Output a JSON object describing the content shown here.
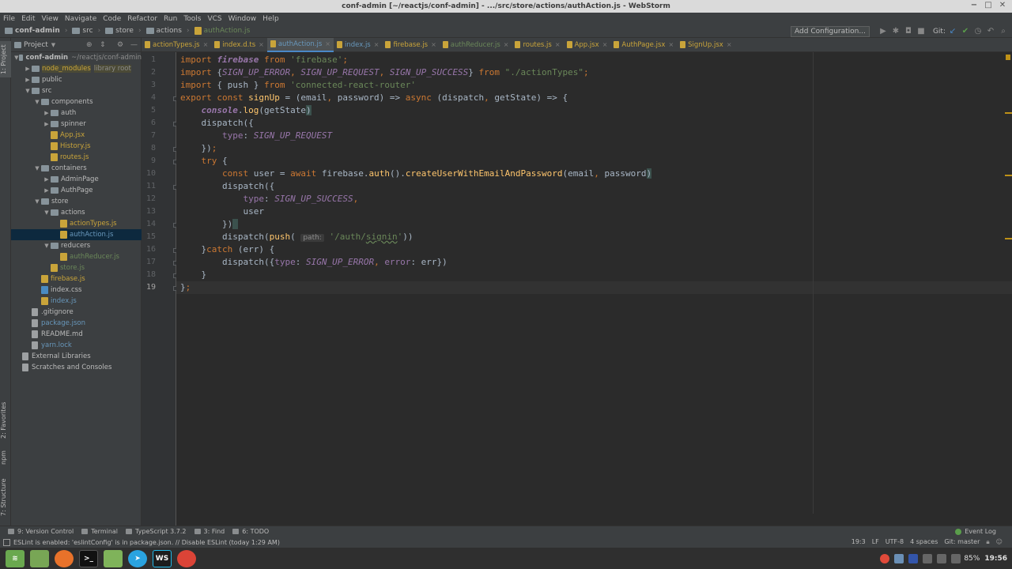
{
  "window": {
    "title": "conf-admin [~/reactjs/conf-admin] - .../src/store/actions/authAction.js - WebStorm"
  },
  "menu": [
    "File",
    "Edit",
    "View",
    "Navigate",
    "Code",
    "Refactor",
    "Run",
    "Tools",
    "VCS",
    "Window",
    "Help"
  ],
  "breadcrumbs": [
    "conf-admin",
    "src",
    "store",
    "actions",
    "authAction.js"
  ],
  "toolbar": {
    "add_config": "Add Configuration...",
    "git_label": "Git:"
  },
  "side_labels": {
    "project": "1: Project",
    "favorites": "2: Favorites",
    "npm": "npm",
    "structure": "7: Structure"
  },
  "project_panel": {
    "title": "Project",
    "tree": [
      {
        "label": "conf-admin",
        "extra": "~/reactjs/conf-admin",
        "indent": 0,
        "arrow": "down",
        "icon": "folder",
        "color": "#bbbbbb",
        "bold": true
      },
      {
        "label": "node_modules",
        "extra": "library root",
        "indent": 1,
        "arrow": "right",
        "icon": "folder",
        "color": "#c9a43a",
        "bg": "#4b4a36"
      },
      {
        "label": "public",
        "indent": 1,
        "arrow": "right",
        "icon": "folder",
        "color": "#bbbbbb"
      },
      {
        "label": "src",
        "indent": 1,
        "arrow": "down",
        "icon": "folder",
        "color": "#bbbbbb"
      },
      {
        "label": "components",
        "indent": 2,
        "arrow": "down",
        "icon": "folder",
        "color": "#bbbbbb"
      },
      {
        "label": "auth",
        "indent": 3,
        "arrow": "right",
        "icon": "folder",
        "color": "#bbbbbb"
      },
      {
        "label": "spinner",
        "indent": 3,
        "arrow": "right",
        "icon": "folder",
        "color": "#bbbbbb"
      },
      {
        "label": "App.jsx",
        "indent": 3,
        "icon": "js",
        "color": "#c9a43a"
      },
      {
        "label": "History.js",
        "indent": 3,
        "icon": "js",
        "color": "#c9a43a"
      },
      {
        "label": "routes.js",
        "indent": 3,
        "icon": "js",
        "color": "#c9a43a"
      },
      {
        "label": "containers",
        "indent": 2,
        "arrow": "down",
        "icon": "folder",
        "color": "#bbbbbb"
      },
      {
        "label": "AdminPage",
        "indent": 3,
        "arrow": "right",
        "icon": "folder",
        "color": "#bbbbbb"
      },
      {
        "label": "AuthPage",
        "indent": 3,
        "arrow": "right",
        "icon": "folder",
        "color": "#bbbbbb"
      },
      {
        "label": "store",
        "indent": 2,
        "arrow": "down",
        "icon": "folder",
        "color": "#bbbbbb"
      },
      {
        "label": "actions",
        "indent": 3,
        "arrow": "down",
        "icon": "folder",
        "color": "#bbbbbb"
      },
      {
        "label": "actionTypes.js",
        "indent": 4,
        "icon": "js",
        "color": "#c9a43a"
      },
      {
        "label": "authAction.js",
        "indent": 4,
        "icon": "js",
        "color": "#6897bb",
        "selected": true
      },
      {
        "label": "reducers",
        "indent": 3,
        "arrow": "down",
        "icon": "folder",
        "color": "#bbbbbb"
      },
      {
        "label": "authReducer.js",
        "indent": 4,
        "icon": "js",
        "color": "#6a8759"
      },
      {
        "label": "store.js",
        "indent": 3,
        "icon": "js",
        "color": "#6a8759"
      },
      {
        "label": "firebase.js",
        "indent": 2,
        "icon": "js",
        "color": "#c9a43a"
      },
      {
        "label": "index.css",
        "indent": 2,
        "icon": "css",
        "color": "#bbbbbb"
      },
      {
        "label": "index.js",
        "indent": 2,
        "icon": "js",
        "color": "#6897bb"
      },
      {
        "label": ".gitignore",
        "indent": 1,
        "icon": "txt",
        "color": "#bbbbbb"
      },
      {
        "label": "package.json",
        "indent": 1,
        "icon": "txt",
        "color": "#6897bb"
      },
      {
        "label": "README.md",
        "indent": 1,
        "icon": "txt",
        "color": "#bbbbbb"
      },
      {
        "label": "yarn.lock",
        "indent": 1,
        "icon": "txt",
        "color": "#6897bb"
      },
      {
        "label": "External Libraries",
        "indent": 0,
        "icon": "lib",
        "color": "#bbbbbb"
      },
      {
        "label": "Scratches and Consoles",
        "indent": 0,
        "icon": "scratch",
        "color": "#bbbbbb"
      }
    ]
  },
  "tabs": [
    {
      "label": "actionTypes.js",
      "color": "#c9a43a"
    },
    {
      "label": "index.d.ts",
      "color": "#c9a43a"
    },
    {
      "label": "authAction.js",
      "color": "#6897bb",
      "active": true
    },
    {
      "label": "index.js",
      "color": "#6897bb"
    },
    {
      "label": "firebase.js",
      "color": "#c9a43a"
    },
    {
      "label": "authReducer.js",
      "color": "#6a8759"
    },
    {
      "label": "routes.js",
      "color": "#c9a43a"
    },
    {
      "label": "App.jsx",
      "color": "#c9a43a"
    },
    {
      "label": "AuthPage.jsx",
      "color": "#c9a43a"
    },
    {
      "label": "SignUp.jsx",
      "color": "#c9a43a"
    }
  ],
  "code": {
    "current_line": 19,
    "lines": [
      [
        [
          "import ",
          "kw"
        ],
        [
          "firebase",
          "ital"
        ],
        [
          " from ",
          "kw"
        ],
        [
          "'firebase'",
          "str"
        ],
        [
          ";",
          "kw"
        ]
      ],
      [
        [
          "import ",
          "kw"
        ],
        [
          "{",
          ""
        ],
        [
          "SIGN_UP_ERROR",
          "const"
        ],
        [
          ", ",
          "kw"
        ],
        [
          "SIGN_UP_REQUEST",
          "const"
        ],
        [
          ", ",
          "kw"
        ],
        [
          "SIGN_UP_SUCCESS",
          "const"
        ],
        [
          "} ",
          ""
        ],
        [
          "from ",
          "kw"
        ],
        [
          "\"./actionTypes\"",
          "str"
        ],
        [
          ";",
          "kw"
        ]
      ],
      [
        [
          "import ",
          "kw"
        ],
        [
          "{ ",
          ""
        ],
        [
          "push",
          "fn2"
        ],
        [
          " } ",
          ""
        ],
        [
          "from ",
          "kw"
        ],
        [
          "'connected-react-router'",
          "str"
        ]
      ],
      [
        [
          "export const ",
          "kw"
        ],
        [
          "signUp",
          "fn"
        ],
        [
          " = (email",
          ""
        ],
        [
          ", ",
          "kw"
        ],
        [
          "password) => ",
          ""
        ],
        [
          "async ",
          "kw"
        ],
        [
          "(dispatch",
          ""
        ],
        [
          ", ",
          "kw"
        ],
        [
          "getState) => {",
          ""
        ]
      ],
      [
        [
          "    ",
          ""
        ],
        [
          "console",
          "ital"
        ],
        [
          ".",
          ""
        ],
        [
          "log",
          "fn"
        ],
        [
          "(getState",
          ""
        ],
        [
          ")",
          "brk"
        ]
      ],
      [
        [
          "    dispatch({",
          ""
        ]
      ],
      [
        [
          "        ",
          ""
        ],
        [
          "type",
          "prop"
        ],
        [
          ": ",
          ""
        ],
        [
          "SIGN_UP_REQUEST",
          "const"
        ]
      ],
      [
        [
          "    })",
          ""
        ],
        [
          ";",
          "kw"
        ]
      ],
      [
        [
          "    ",
          ""
        ],
        [
          "try ",
          "kw"
        ],
        [
          "{",
          ""
        ]
      ],
      [
        [
          "        ",
          ""
        ],
        [
          "const ",
          "kw"
        ],
        [
          "user = ",
          ""
        ],
        [
          "await ",
          "kw"
        ],
        [
          "firebase.",
          ""
        ],
        [
          "auth",
          "fn"
        ],
        [
          "().",
          ""
        ],
        [
          "createUserWithEmailAndPassword",
          "fn"
        ],
        [
          "(email",
          ""
        ],
        [
          ", ",
          "kw"
        ],
        [
          "password",
          ""
        ],
        [
          ")",
          "brk"
        ]
      ],
      [
        [
          "        dispatch({",
          ""
        ]
      ],
      [
        [
          "            ",
          ""
        ],
        [
          "type",
          "prop"
        ],
        [
          ": ",
          ""
        ],
        [
          "SIGN_UP_SUCCESS",
          "const"
        ],
        [
          ",",
          "kw"
        ]
      ],
      [
        [
          "            user",
          ""
        ]
      ],
      [
        [
          "        })",
          ""
        ],
        [
          " ",
          "brk"
        ]
      ],
      [
        [
          "        dispatch(",
          ""
        ],
        [
          "push",
          "fn"
        ],
        [
          "( ",
          ""
        ],
        [
          "path:",
          "hint"
        ],
        [
          " ",
          ""
        ],
        [
          "'/auth/",
          "str"
        ],
        [
          "signin",
          "strul"
        ],
        [
          "'",
          "str"
        ],
        [
          "))",
          ""
        ]
      ],
      [
        [
          "    }",
          ""
        ],
        [
          "catch ",
          "kw"
        ],
        [
          "(err) {",
          ""
        ]
      ],
      [
        [
          "        dispatch({",
          ""
        ],
        [
          "type",
          "prop"
        ],
        [
          ": ",
          ""
        ],
        [
          "SIGN_UP_ERROR",
          "const"
        ],
        [
          ", ",
          "kw"
        ],
        [
          "error",
          "prop"
        ],
        [
          ": err})",
          ""
        ]
      ],
      [
        [
          "    }",
          ""
        ]
      ],
      [
        [
          "}",
          ""
        ],
        [
          ";",
          "kw"
        ]
      ]
    ]
  },
  "bottom_tools": [
    "9: Version Control",
    "Terminal",
    "TypeScript 3.7.2",
    "3: Find",
    "6: TODO"
  ],
  "event_log": "Event Log",
  "status": {
    "message": "ESLint is enabled: 'eslintConfig' is in package.json. // Disable ESLint (today 1:29 AM)",
    "position": "19:3",
    "line_sep": "LF",
    "encoding": "UTF-8",
    "indent": "4 spaces",
    "vcs": "Git: master"
  },
  "taskbar": {
    "battery": "85%",
    "time": "19:56"
  }
}
